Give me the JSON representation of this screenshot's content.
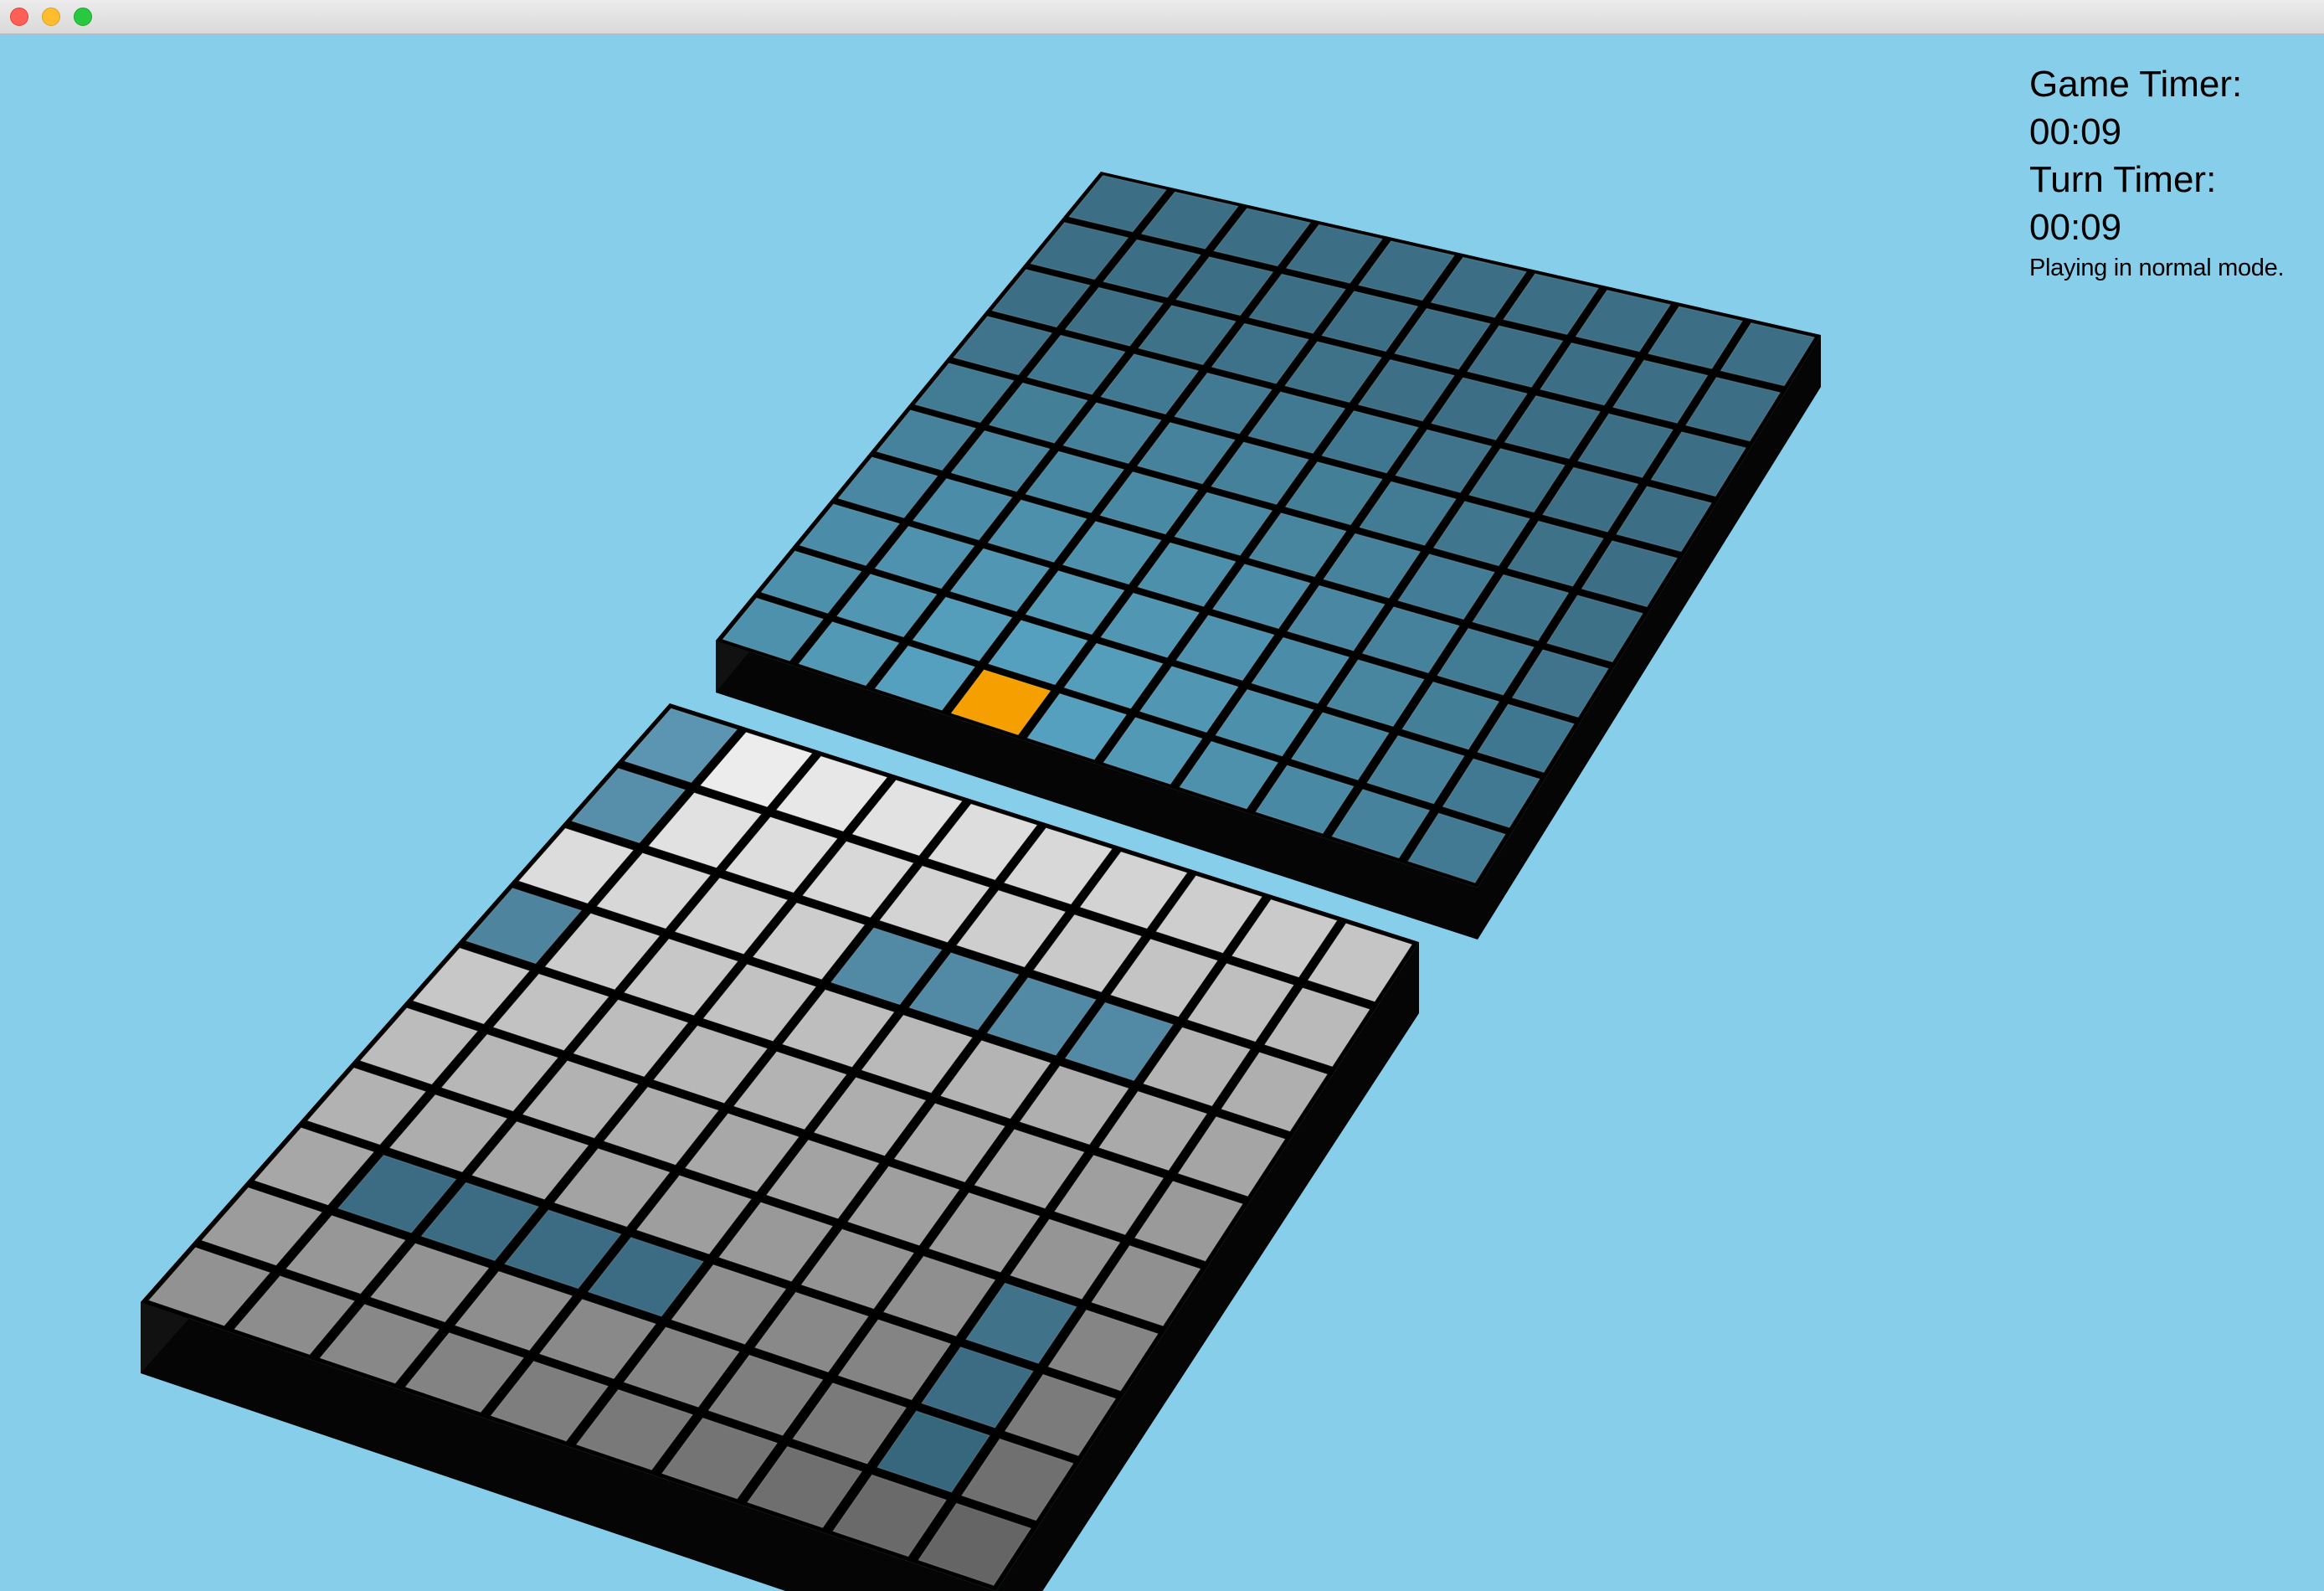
{
  "window": {
    "controls": [
      "close",
      "minimize",
      "maximize"
    ]
  },
  "hud": {
    "game_timer_label": "Game Timer:",
    "game_timer_value": "00:09",
    "turn_timer_label": "Turn Timer:",
    "turn_timer_value": "00:09",
    "mode_text": "Playing in normal mode."
  },
  "boards": {
    "grid_size": 10,
    "opponent_board": {
      "cell_color": "#3c6f86",
      "highlight_color": "#5aa8c8",
      "selected_cell": {
        "row": 9,
        "col": 3,
        "color": "#f5a000"
      }
    },
    "player_board": {
      "cell_color": "#a9a9a9",
      "ship_color": "#437d99",
      "ship_cells": [
        [
          0,
          0
        ],
        [
          1,
          0
        ],
        [
          3,
          0
        ],
        [
          2,
          4
        ],
        [
          2,
          5
        ],
        [
          2,
          6
        ],
        [
          2,
          7
        ],
        [
          6,
          8
        ],
        [
          7,
          8
        ],
        [
          8,
          8
        ],
        [
          7,
          1
        ],
        [
          7,
          2
        ],
        [
          7,
          3
        ],
        [
          7,
          4
        ]
      ]
    },
    "side_color": "#050505",
    "grid_line_color": "#000000"
  }
}
